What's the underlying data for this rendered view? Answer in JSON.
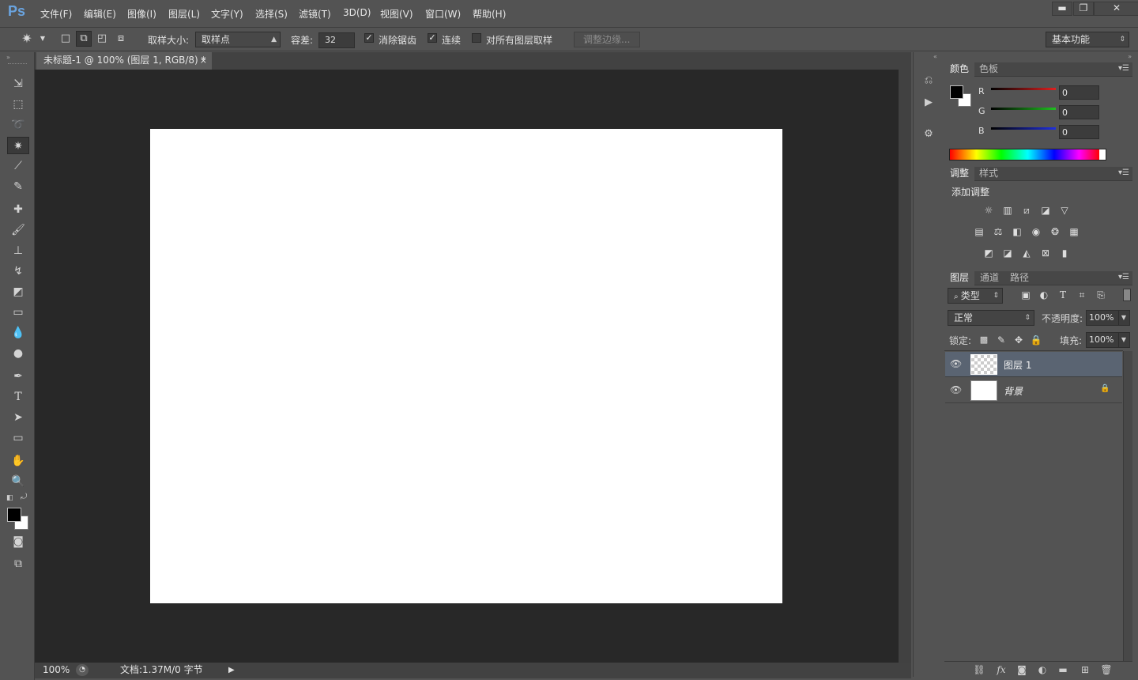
{
  "app": {
    "logo": "Ps"
  },
  "menu": [
    "文件(F)",
    "编辑(E)",
    "图像(I)",
    "图层(L)",
    "文字(Y)",
    "选择(S)",
    "滤镜(T)",
    "3D(D)",
    "视图(V)",
    "窗口(W)",
    "帮助(H)"
  ],
  "window_controls": {
    "minimize": "▬",
    "restore": "❐",
    "close": "✕"
  },
  "options": {
    "sample_size_label": "取样大小:",
    "sample_size_value": "取样点",
    "tolerance_label": "容差:",
    "tolerance_value": "32",
    "anti_alias_label": "消除锯齿",
    "anti_alias_checked": true,
    "contiguous_label": "连续",
    "contiguous_checked": true,
    "all_layers_label": "对所有图层取样",
    "all_layers_checked": false,
    "refine_edge_label": "调整边缘...",
    "workspace_value": "基本功能"
  },
  "document": {
    "tab_title": "未标题-1 @ 100% (图层 1, RGB/8) *",
    "tab_close": "×",
    "canvas_color": "#ffffff"
  },
  "status": {
    "zoom": "100%",
    "doc_info": "文档:1.37M/0 字节"
  },
  "color_panel": {
    "tabs": [
      "颜色",
      "色板"
    ],
    "channels": [
      {
        "label": "R",
        "value": "0",
        "color": "#e02020"
      },
      {
        "label": "G",
        "value": "0",
        "color": "#20c020"
      },
      {
        "label": "B",
        "value": "0",
        "color": "#2030e0"
      }
    ]
  },
  "adjust_panel": {
    "tabs": [
      "调整",
      "样式"
    ],
    "title": "添加调整",
    "icons_row1": [
      "brightness-icon",
      "levels-icon",
      "curves-icon",
      "exposure-icon",
      "vibrance-icon"
    ],
    "icons_row2": [
      "hue-sat-icon",
      "color-balance-icon",
      "black-white-icon",
      "photo-filter-icon",
      "channel-mixer-icon",
      "color-lookup-icon"
    ],
    "icons_row3": [
      "invert-icon",
      "posterize-icon",
      "threshold-icon",
      "selective-color-icon",
      "gradient-map-icon"
    ]
  },
  "layers_panel": {
    "tabs": [
      "图层",
      "通道",
      "路径"
    ],
    "filter_kind": "类型",
    "blend_mode": "正常",
    "opacity_label": "不透明度:",
    "opacity_value": "100%",
    "lock_label": "锁定:",
    "fill_label": "填充:",
    "fill_value": "100%",
    "layers": [
      {
        "name": "图层 1",
        "selected": true,
        "transparent": true
      },
      {
        "name": "背景",
        "selected": false,
        "locked": true
      }
    ]
  },
  "colors": {
    "fg": "#000000",
    "bg": "#ffffff",
    "selected_layer": "#5a6472"
  }
}
